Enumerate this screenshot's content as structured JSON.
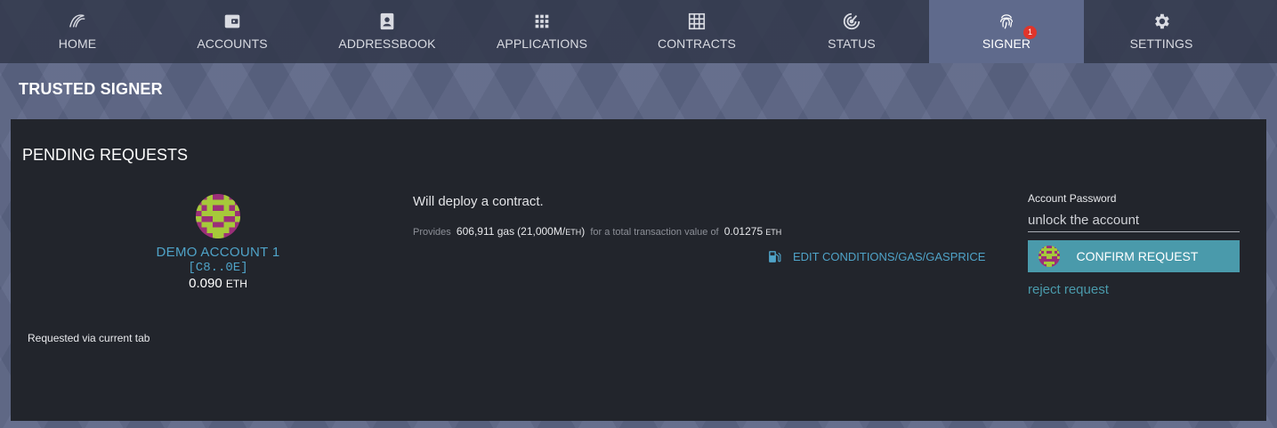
{
  "tabs": [
    {
      "label": "HOME",
      "icon": "parity-logo-icon"
    },
    {
      "label": "ACCOUNTS",
      "icon": "wallet-icon"
    },
    {
      "label": "ADDRESSBOOK",
      "icon": "contact-card-icon"
    },
    {
      "label": "APPLICATIONS",
      "icon": "apps-grid-icon"
    },
    {
      "label": "CONTRACTS",
      "icon": "table-grid-icon"
    },
    {
      "label": "STATUS",
      "icon": "radar-icon"
    },
    {
      "label": "SIGNER",
      "icon": "fingerprint-icon",
      "badge": "1",
      "active": true
    },
    {
      "label": "SETTINGS",
      "icon": "gear-icon"
    }
  ],
  "page": {
    "title": "TRUSTED SIGNER"
  },
  "panel": {
    "title": "PENDING REQUESTS",
    "account": {
      "name": "DEMO ACCOUNT 1",
      "address": "[C8..0E]",
      "balance_value": "0.090",
      "balance_unit": "ETH"
    },
    "requested_via": "Requested via current tab",
    "description": "Will deploy a contract.",
    "detail": {
      "provides_label": "Provides",
      "gas_amount": "606,911 gas",
      "gas_price": "(21,000M/",
      "gas_price_unit": "ETH",
      "gas_price_close": ")",
      "total_label": "for a total transaction value of",
      "total_value": "0.01275",
      "total_unit": "ETH"
    },
    "edit_link": "EDIT CONDITIONS/GAS/GASPRICE",
    "password_label": "Account Password",
    "password_placeholder": "unlock the account",
    "confirm_label": "CONFIRM REQUEST",
    "reject_label": "reject request"
  },
  "colors": {
    "accent": "#4fa3c8",
    "button": "#4a9aab",
    "badge": "#e0352b",
    "panel": "#22252c"
  }
}
